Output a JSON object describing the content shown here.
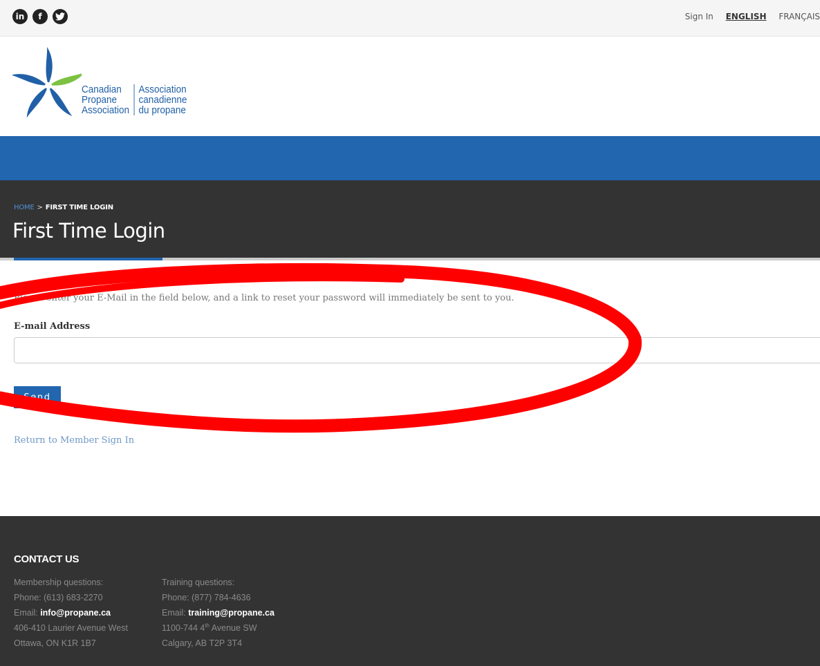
{
  "social": {
    "linkedin_glyph": "in",
    "facebook_glyph": "f"
  },
  "toplinks": {
    "sign_in": "Sign In",
    "english": "ENGLISH",
    "french": "FRANÇAIS"
  },
  "logo": {
    "en": [
      "Canadian",
      "Propane",
      "Association"
    ],
    "fr": [
      "Association",
      "canadienne",
      "du propane"
    ]
  },
  "breadcrumb": {
    "home": "HOME",
    "separator": ">",
    "current": "FIRST TIME LOGIN"
  },
  "page": {
    "title": "First Time Login"
  },
  "form": {
    "intro": "Please enter your E-Mail in the field below, and a link to reset your password will immediately be sent to you.",
    "email_label": "E-mail Address",
    "email_value": "",
    "send_label": "Send",
    "return_link": "Return to Member Sign In"
  },
  "footer": {
    "title": "CONTACT US",
    "membership": {
      "heading": "Membership questions:",
      "phone": "Phone: (613) 683-2270",
      "email_prefix": "Email: ",
      "email": "info@propane.ca",
      "address1": "406-410 Laurier Avenue West",
      "address2": "Ottawa, ON K1R 1B7"
    },
    "training": {
      "heading": "Training questions:",
      "phone": "Phone: (877) 784-4636",
      "email_prefix": "Email: ",
      "email": "training@propane.ca",
      "address1_pre": "1100-744 4",
      "address1_sup": "th",
      "address1_post": " Avenue SW",
      "address2": "Calgary, AB T2P 3T4"
    }
  },
  "colors": {
    "brand_blue": "#2166ae",
    "dark_band": "#333333",
    "annotation_red": "#ff0000"
  }
}
